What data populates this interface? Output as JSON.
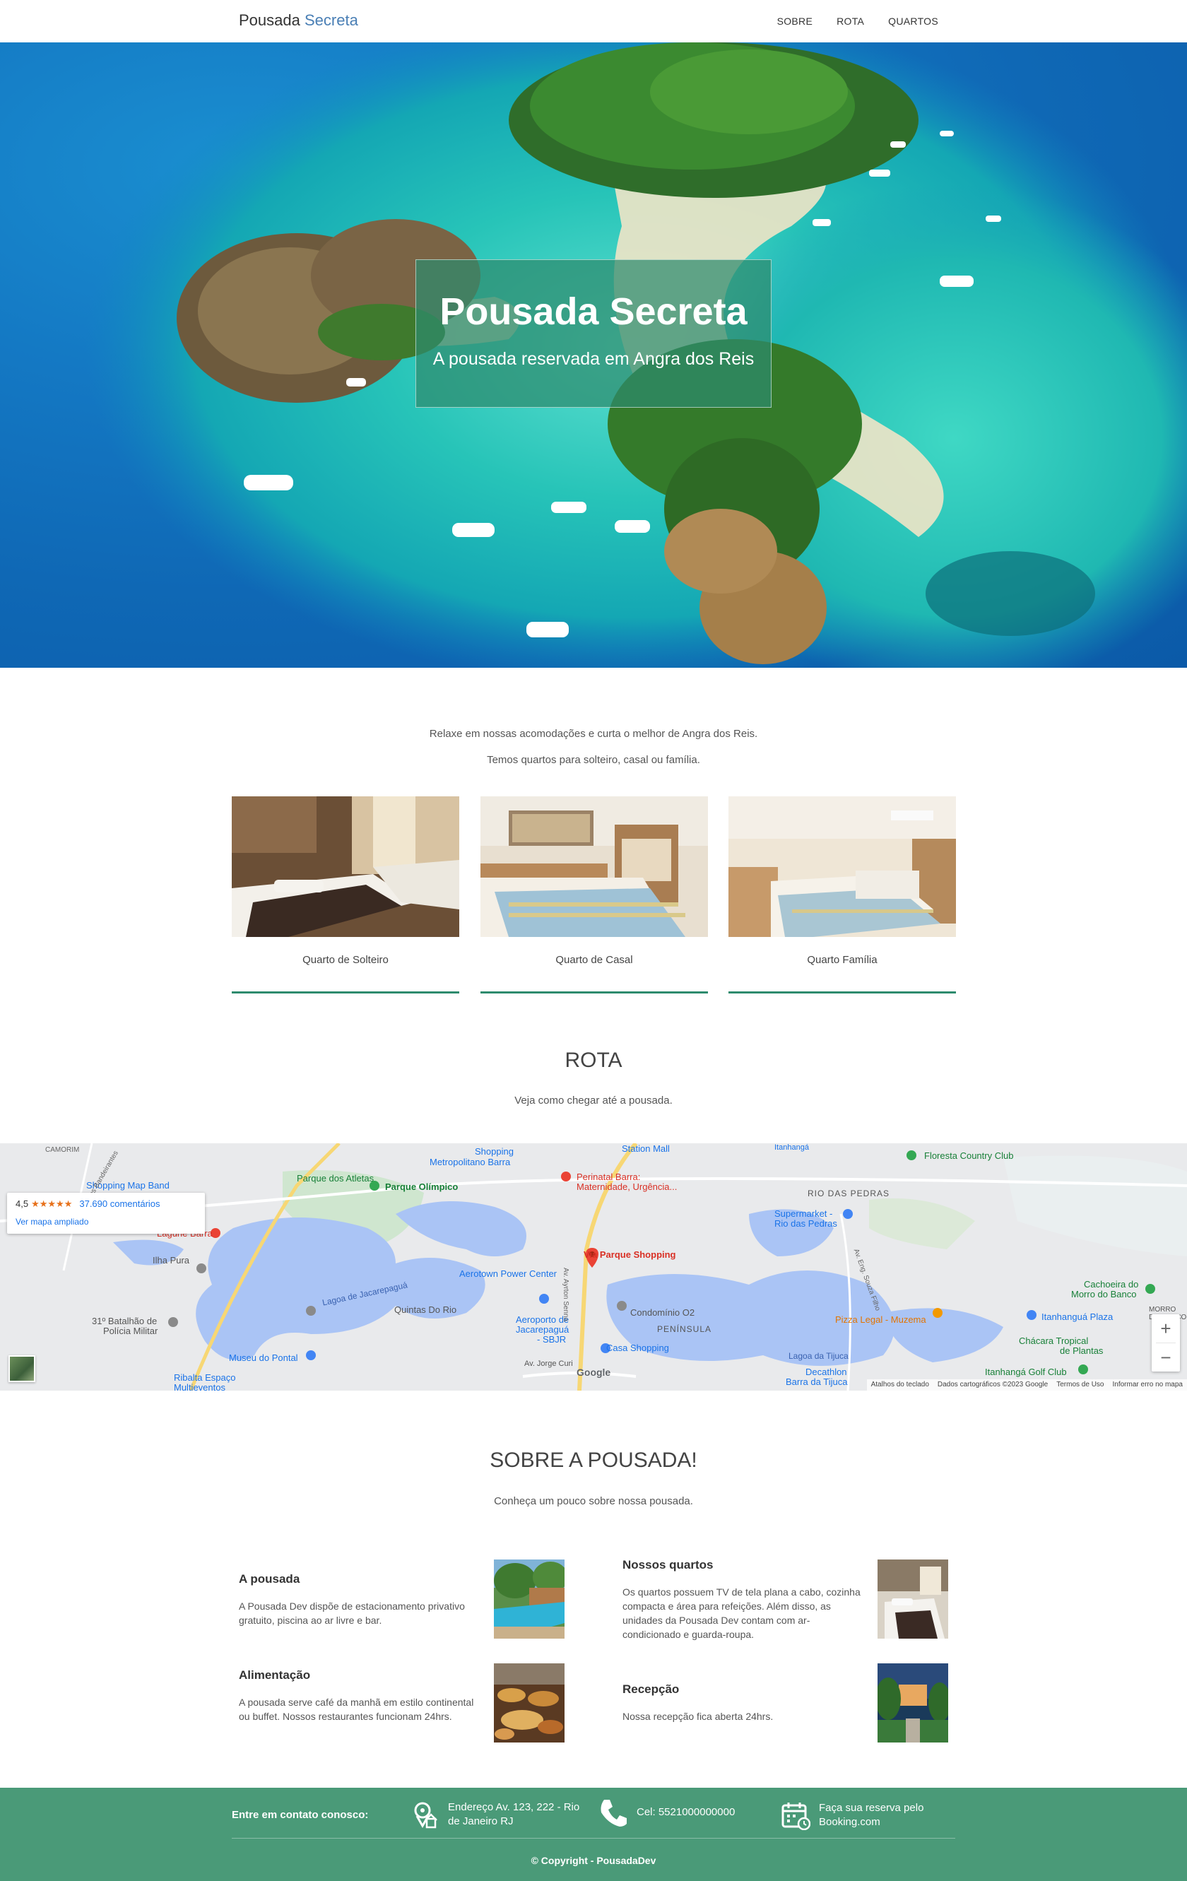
{
  "nav": {
    "brand_main": "Pousada",
    "brand_accent": "Secreta",
    "links": [
      "SOBRE",
      "ROTA",
      "QUARTOS"
    ]
  },
  "hero": {
    "title": "Pousada Secreta",
    "subtitle": "A pousada reservada em Angra dos Reis"
  },
  "intro": {
    "line1": "Relaxe em nossas acomodações e curta o melhor de Angra dos Reis.",
    "line2": "Temos quartos para solteiro, casal ou família."
  },
  "rooms": [
    {
      "name": "Quarto de Solteiro"
    },
    {
      "name": "Quarto de Casal"
    },
    {
      "name": "Quarto Família"
    }
  ],
  "route": {
    "title": "ROTA",
    "subtitle": "Veja como chegar até a pousada."
  },
  "map": {
    "rating": "4,5",
    "stars": "★★★★★",
    "reviews": "37.690 comentários",
    "expand_link": "Ver mapa ampliado",
    "marker_label": "Via Parque Shopping",
    "zoom_in": "+",
    "zoom_out": "−",
    "google": "Google",
    "footer_links": [
      "Atalhos do teclado",
      "Dados cartográficos ©2023 Google",
      "Termos de Uso",
      "Informar erro no mapa"
    ],
    "labels": {
      "camorim": "CAMORIM",
      "shopping_map_band": "Shopping Map Band",
      "parque_atletas": "Parque dos Atletas",
      "parque_olimpico": "Parque Olímpico",
      "shopping_metropolitano": "Metropolitano Barra",
      "shopping": "Shopping",
      "station_mall": "Station Mall",
      "itanhanga": "Itanhangá",
      "floresta": "Floresta Country Club",
      "perinatal1": "Perinatal Barra:",
      "perinatal2": "Maternidade, Urgência...",
      "rio_das_pedras": "RIO DAS PEDRAS",
      "supermarket1": "Supermarket -",
      "supermarket2": "Rio das Pedras",
      "lagune": "Lagune Barra",
      "ilha_pura": "Ilha Pura",
      "aerotown": "Aerotown Power Center",
      "lagoa_jacarepagua": "Lagoa de Jacarepaguá",
      "quintas": "Quintas Do Rio",
      "condominio": "Condomínio O2",
      "peninsula": "PENÍNSULA",
      "aeroporto1": "Aeroporto de",
      "aeroporto2": "Jacarepaguá",
      "aeroporto3": "- SBJR",
      "casa_shopping": "Casa Shopping",
      "batalhao1": "31º Batalhão de",
      "batalhao2": "Polícia Militar",
      "museu": "Museu do Pontal",
      "ribalta1": "Ribalta Espaço",
      "ribalta2": "Multieventos",
      "pizza": "Pizza Legal - Muzema",
      "cachoeira1": "Cachoeira do",
      "cachoeira2": "Morro do Banco",
      "itanhangu_plaza": "Itanhanguá Plaza",
      "chacara1": "Chácara Tropical",
      "chacara2": "de Plantas",
      "itanhanga_golf": "Itanhangá Golf Club",
      "lagoa_tijuca": "Lagoa da Tijuca",
      "decathlon1": "Decathlon",
      "decathlon2": "Barra da Tijuca",
      "morro": "MORRO DO BANCO",
      "av_jorge": "Av. Jorge Curi",
      "av_ayrton": "Av. Ayrton Senna",
      "av_eng": "Av. Eng. Souza Filho",
      "est_bandeirantes": "Estr. dos Bandeirantes"
    }
  },
  "about": {
    "title": "SOBRE A POUSADA!",
    "subtitle": "Conheça um pouco sobre nossa pousada.",
    "items": [
      {
        "title": "A pousada",
        "text": "A Pousada Dev dispõe de estacionamento privativo gratuito, piscina ao ar livre e bar."
      },
      {
        "title": "Nossos quartos",
        "text": "Os quartos possuem TV de tela plana a cabo, cozinha compacta e área para refeições. Além disso, as unidades da Pousada Dev contam com ar-condicionado e guarda-roupa."
      },
      {
        "title": "Alimentação",
        "text": "A pousada serve café da manhã em estilo continental ou buffet. Nossos restaurantes funcionam 24hrs."
      },
      {
        "title": "Recepção",
        "text": "Nossa recepção fica aberta 24hrs."
      }
    ]
  },
  "footer": {
    "contact_label": "Entre em contato conosco:",
    "address_line1": "Endereço Av. 123, 222 - Rio",
    "address_line2": "de Janeiro RJ",
    "phone": "Cel: 5521000000000",
    "booking_line1": "Faça sua reserva pelo",
    "booking_line2": "Booking.com",
    "copyright": "© Copyright - PousadaDev"
  },
  "colors": {
    "accent_green": "#2e8b6e",
    "footer_bg": "#4a9a78",
    "brand_blue": "#4a7fb5"
  }
}
